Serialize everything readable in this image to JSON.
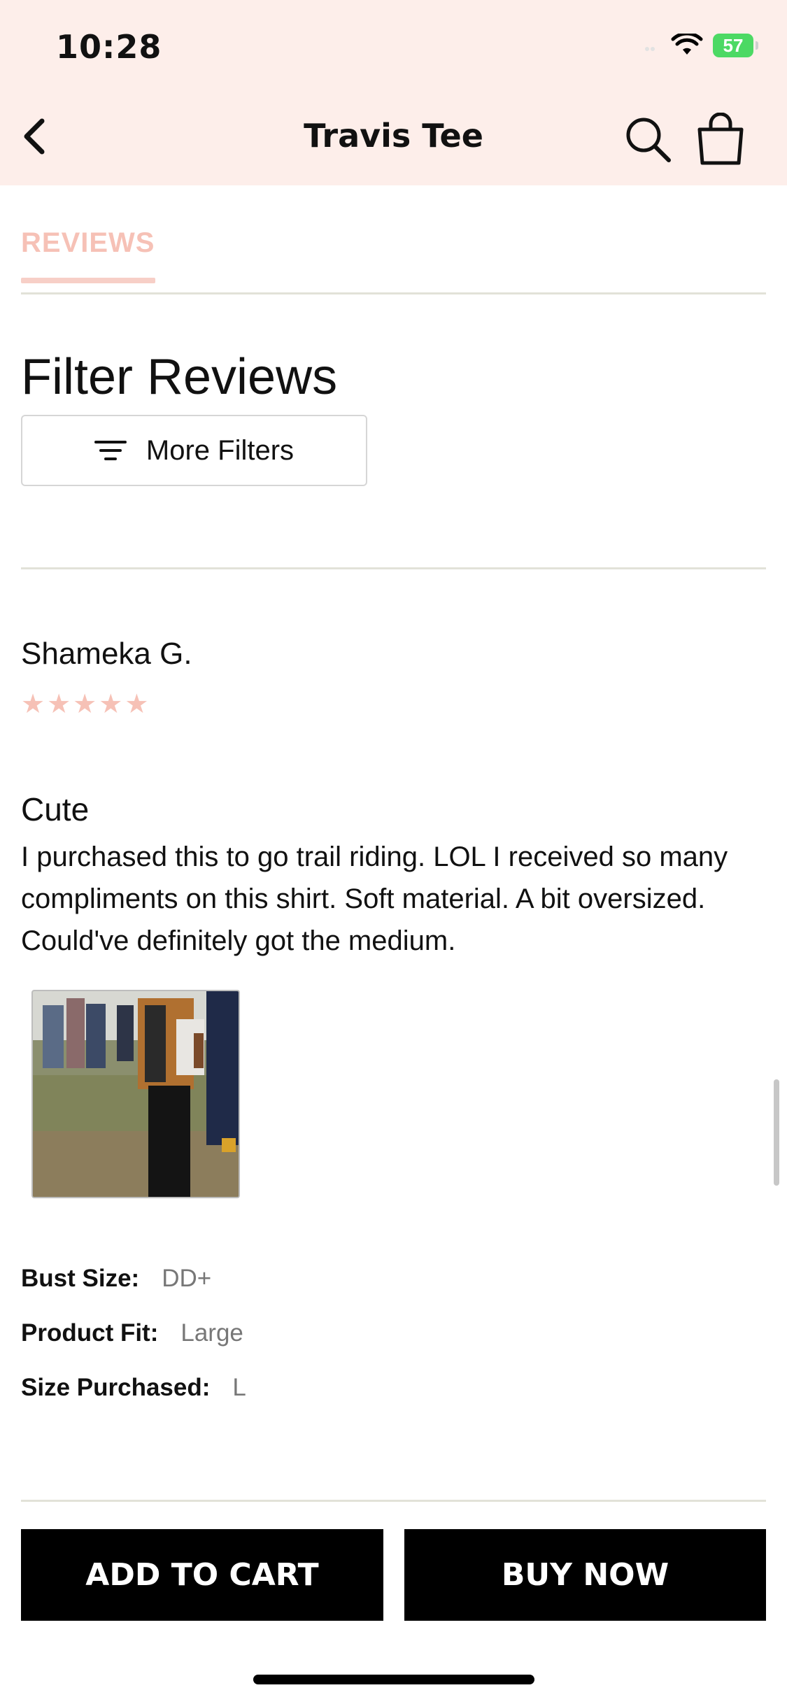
{
  "status_bar": {
    "time": "10:28",
    "battery": "57"
  },
  "nav": {
    "title": "Travis Tee"
  },
  "tabs": {
    "active_label": "REVIEWS"
  },
  "filters": {
    "heading": "Filter Reviews",
    "more_filters_label": "More Filters"
  },
  "review": {
    "reviewer": "Shameka G.",
    "rating": 5,
    "title": "Cute",
    "body": "I purchased this to go trail riding. LOL I received so many compliments on this shirt. Soft material. A bit oversized. Could've definitely got the medium.",
    "attributes": [
      {
        "label": "Bust Size:",
        "value": "DD+"
      },
      {
        "label": "Product Fit:",
        "value": "Large"
      },
      {
        "label": "Size Purchased:",
        "value": "L"
      }
    ]
  },
  "actions": {
    "add_to_cart": "ADD TO CART",
    "buy_now": "BUY NOW"
  },
  "colors": {
    "header_bg": "#fdeeea",
    "accent_pink": "#f6c1b6",
    "button_bg": "#000000",
    "button_text": "#ffffff"
  },
  "icons": [
    "back-chevron-icon",
    "search-icon",
    "shopping-bag-icon",
    "filter-lines-icon",
    "star-icon",
    "wifi-icon",
    "battery-icon"
  ]
}
